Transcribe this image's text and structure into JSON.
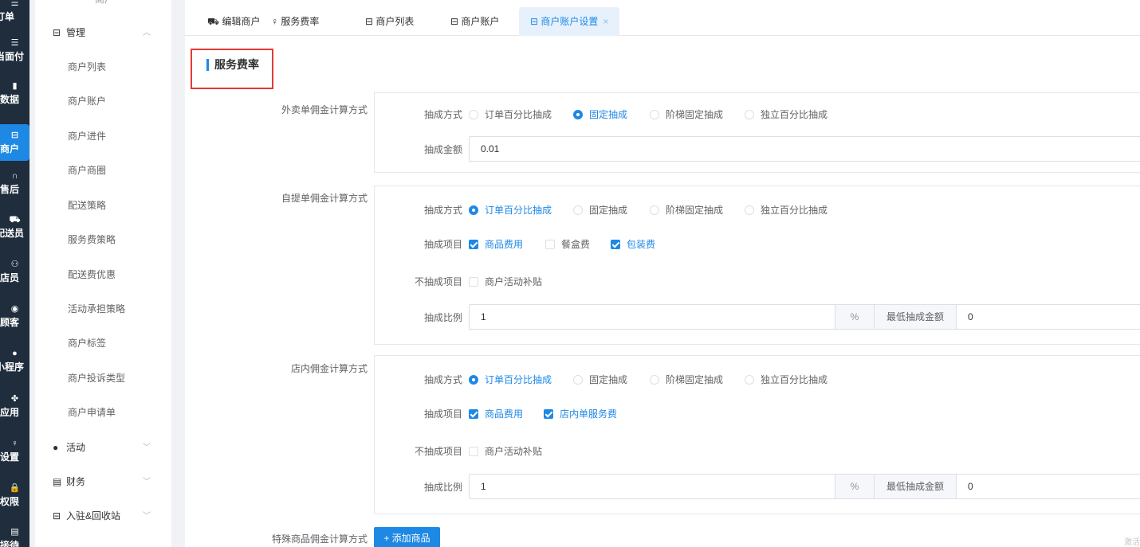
{
  "rail": [
    {
      "icon": "☰",
      "label": "订单",
      "active": false
    },
    {
      "icon": "☰",
      "label": "当面付",
      "active": false
    },
    {
      "icon": "▮",
      "label": "数据",
      "active": false
    },
    {
      "icon": "⊟",
      "label": "商户",
      "active": true
    },
    {
      "icon": "∩",
      "label": "售后",
      "active": false
    },
    {
      "icon": "⛟",
      "label": "配送员",
      "active": false
    },
    {
      "icon": "⚇",
      "label": "店员",
      "active": false
    },
    {
      "icon": "◉",
      "label": "顾客",
      "active": false
    },
    {
      "icon": "●",
      "label": "小程序",
      "active": false
    },
    {
      "icon": "✤",
      "label": "应用",
      "active": false
    },
    {
      "icon": "♀",
      "label": "设置",
      "active": false
    },
    {
      "icon": "🔒",
      "label": "权限",
      "active": false
    },
    {
      "icon": "▤",
      "label": "接待",
      "active": false
    }
  ],
  "submenu": {
    "top_partial": "商户",
    "manage_group": "管理",
    "items": [
      "商户列表",
      "商户账户",
      "商户进件",
      "商户商圈",
      "配送策略",
      "服务费策略",
      "配送费优惠",
      "活动承担策略",
      "商户标签",
      "商户投诉类型",
      "商户申请单"
    ],
    "groups": [
      "活动",
      "财务",
      "入驻&回收站"
    ]
  },
  "tabs": [
    {
      "label": "编辑商户",
      "icon": "⛟"
    },
    {
      "label": "服务费率",
      "icon": "♀"
    },
    {
      "label": "商户列表",
      "icon": "⊟"
    },
    {
      "label": "商户账户",
      "icon": "⊟"
    },
    {
      "label": "商户账户设置",
      "icon": "⊟",
      "close": "×"
    }
  ],
  "page_title": "服务费率",
  "sections": {
    "takeout": {
      "label": "外卖单佣金计算方式",
      "method_label": "抽成方式",
      "options": [
        "订单百分比抽成",
        "固定抽成",
        "阶梯固定抽成",
        "独立百分比抽成"
      ],
      "selected": 1,
      "amount_label": "抽成金额",
      "amount_value": "0.01"
    },
    "pickup": {
      "label": "自提单佣金计算方式",
      "method_label": "抽成方式",
      "options": [
        "订单百分比抽成",
        "固定抽成",
        "阶梯固定抽成",
        "独立百分比抽成"
      ],
      "selected": 0,
      "items_label": "抽成项目",
      "items": [
        {
          "label": "商品费用",
          "checked": true
        },
        {
          "label": "餐盒费",
          "checked": false
        },
        {
          "label": "包装费",
          "checked": true
        }
      ],
      "exclude_label": "不抽成项目",
      "exclude_items": [
        {
          "label": "商户活动补贴",
          "checked": false
        }
      ],
      "ratio_label": "抽成比例",
      "ratio_value": "1",
      "ratio_unit": "%",
      "min_label": "最低抽成金额",
      "min_value": "0"
    },
    "instore": {
      "label": "店内佣金计算方式",
      "method_label": "抽成方式",
      "options": [
        "订单百分比抽成",
        "固定抽成",
        "阶梯固定抽成",
        "独立百分比抽成"
      ],
      "selected": 0,
      "items_label": "抽成项目",
      "items": [
        {
          "label": "商品费用",
          "checked": true
        },
        {
          "label": "店内单服务费",
          "checked": true
        }
      ],
      "exclude_label": "不抽成项目",
      "exclude_items": [
        {
          "label": "商户活动补贴",
          "checked": false
        }
      ],
      "ratio_label": "抽成比例",
      "ratio_value": "1",
      "ratio_unit": "%",
      "min_label": "最低抽成金额",
      "min_value": "0"
    },
    "special": {
      "label": "特殊商品佣金计算方式",
      "add_button": "+ 添加商品"
    }
  },
  "watermark": "激活"
}
